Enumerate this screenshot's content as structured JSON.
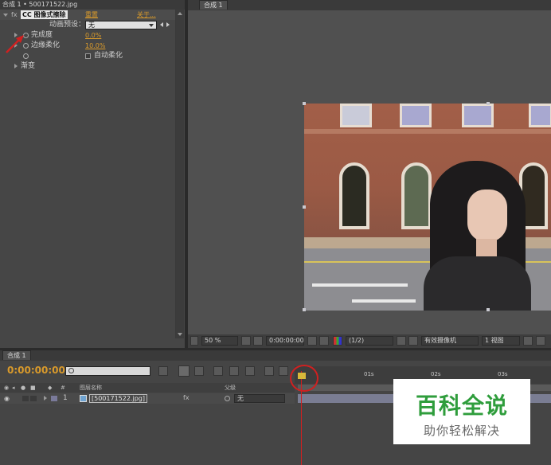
{
  "effect_controls": {
    "header_title": "合成 1 • 500171522.jpg",
    "effect_name": "CC 图像式擦除",
    "reset_label": "重置",
    "about_label": "关于...",
    "animation_preset_label": "动画预设：",
    "animation_preset_value": "无",
    "properties": [
      {
        "label": "完成度",
        "value": "0.0%"
      },
      {
        "label": "边缘柔化",
        "value": "10.0%"
      },
      {
        "label": "",
        "value": "自动柔化"
      }
    ],
    "gradient_label": "渐变"
  },
  "composition": {
    "tab_label": "合成 1",
    "zoom": "50 %",
    "timecode": "0:00:00:00",
    "resolution": "(1/2)",
    "camera": "有效摄像机",
    "views": "1 视图"
  },
  "timeline": {
    "tab_label": "合成 1",
    "timecode": "0:00:00:00",
    "search_placeholder": "",
    "col_layer_name": "图层名称",
    "col_parent": "父级",
    "ruler_marks": [
      "01s",
      "02s",
      "03s"
    ],
    "layer": {
      "number": "1",
      "name": "[500171522.jpg]",
      "parent": "无"
    }
  },
  "watermark": {
    "title": "百科全说",
    "subtitle": "助你轻松解决"
  },
  "colors": {
    "accent_orange": "#d99a2b",
    "playhead_red": "#d02020",
    "watermark_green": "#2f9d3c"
  }
}
